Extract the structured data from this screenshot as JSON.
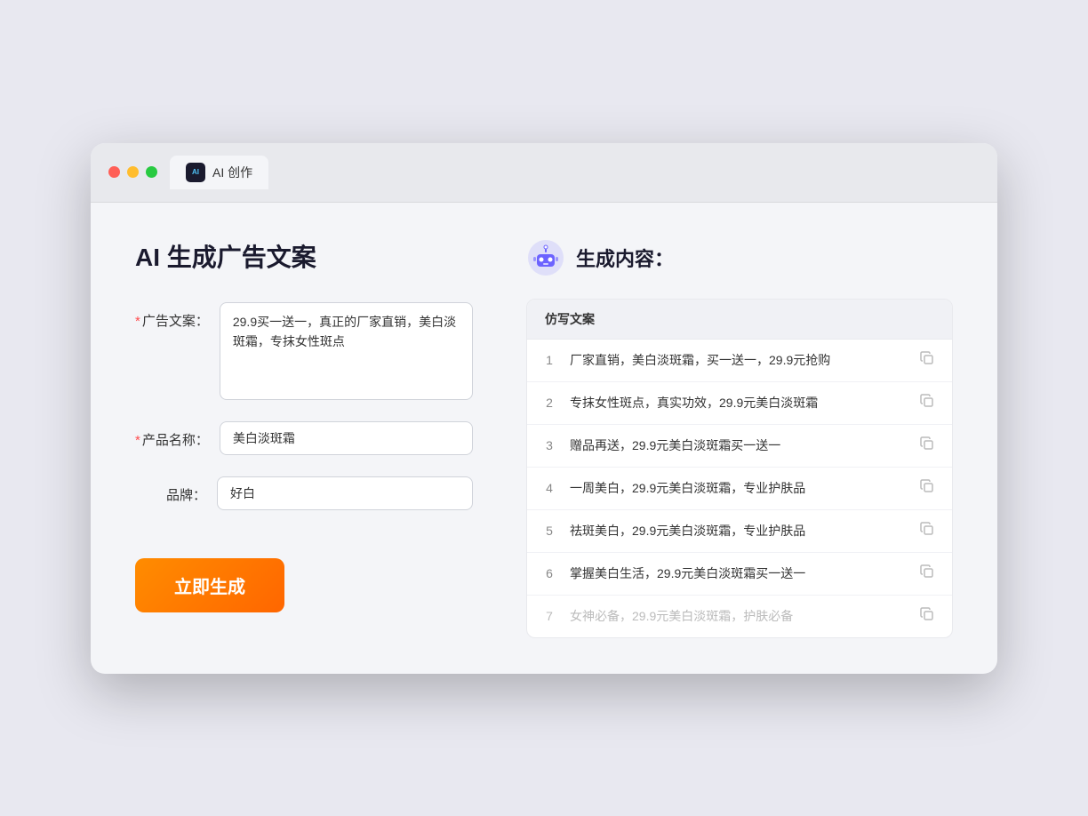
{
  "browser": {
    "tab_label": "AI 创作"
  },
  "page": {
    "title": "AI 生成广告文案"
  },
  "form": {
    "ad_label": "广告文案：",
    "ad_required": "*",
    "ad_value": "29.9买一送一，真正的厂家直销，美白淡斑霜，专抹女性斑点",
    "product_label": "产品名称：",
    "product_required": "*",
    "product_value": "美白淡斑霜",
    "brand_label": "品牌：",
    "brand_value": "好白",
    "generate_button": "立即生成"
  },
  "result": {
    "title": "生成内容：",
    "table_header": "仿写文案",
    "rows": [
      {
        "num": "1",
        "text": "厂家直销，美白淡斑霜，买一送一，29.9元抢购",
        "faded": false
      },
      {
        "num": "2",
        "text": "专抹女性斑点，真实功效，29.9元美白淡斑霜",
        "faded": false
      },
      {
        "num": "3",
        "text": "赠品再送，29.9元美白淡斑霜买一送一",
        "faded": false
      },
      {
        "num": "4",
        "text": "一周美白，29.9元美白淡斑霜，专业护肤品",
        "faded": false
      },
      {
        "num": "5",
        "text": "祛斑美白，29.9元美白淡斑霜，专业护肤品",
        "faded": false
      },
      {
        "num": "6",
        "text": "掌握美白生活，29.9元美白淡斑霜买一送一",
        "faded": false
      },
      {
        "num": "7",
        "text": "女神必备，29.9元美白淡斑霜，护肤必备",
        "faded": true
      }
    ]
  }
}
